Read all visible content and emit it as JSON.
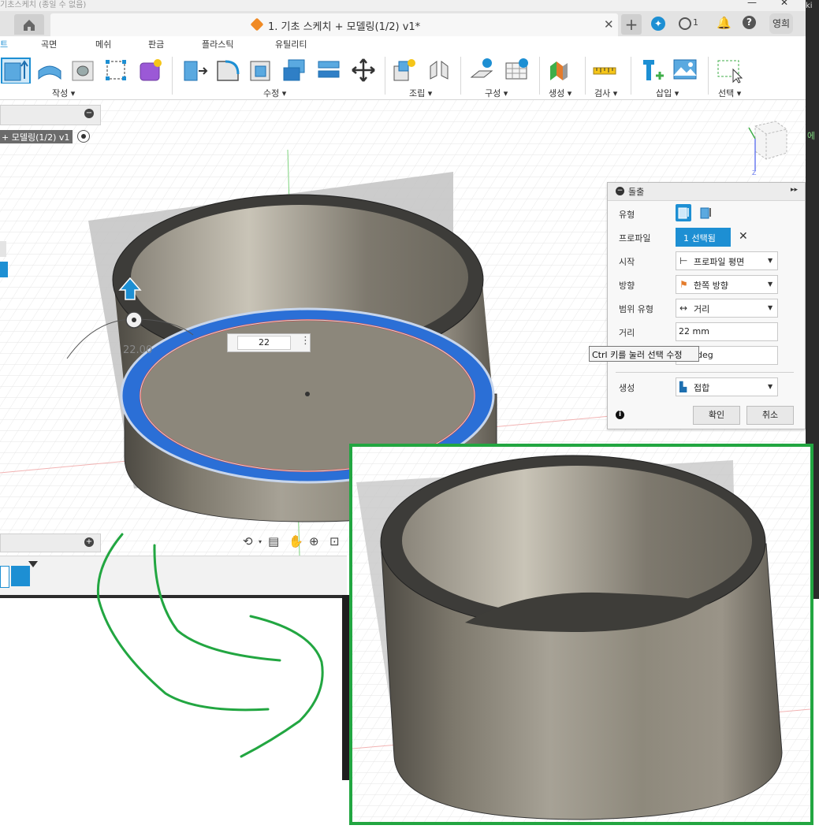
{
  "window": {
    "title_fragment": "기초스케치 (종일 수 없음)",
    "right_edge_text": "ki",
    "right_edge_text2": "에"
  },
  "tabbar": {
    "doc_title": "1. 기초 스케치 + 모델링(1/2) v1*",
    "close_glyph": "✕",
    "plus_glyph": "+",
    "job_count": "1",
    "user_initials": "영희"
  },
  "menu": [
    "트",
    "곡면",
    "메쉬",
    "판금",
    "플라스틱",
    "유틸리티"
  ],
  "toolbar": {
    "groups": [
      "작성 ▾",
      "수정 ▾",
      "조립 ▾",
      "구성 ▾",
      "생성 ▾",
      "검사 ▾",
      "삽입 ▾",
      "선택 ▾"
    ]
  },
  "browser": {
    "item": "+ 모델링(1/2) v1",
    "collapse": "−",
    "expand": "+"
  },
  "viewport": {
    "dimension_value": "22",
    "dimension_label": "22.00"
  },
  "dialog": {
    "title": "돌출",
    "expand_glyph": "▸▸",
    "rows": {
      "type": "유형",
      "profile": "프로파일",
      "start": "시작",
      "direction": "방향",
      "extent": "범위 유형",
      "distance": "거리",
      "operation": "생성"
    },
    "profile_selected": "1 선택됨",
    "start_value": "프로파일 평면",
    "direction_value": "한쪽 방향",
    "extent_value": "거리",
    "distance_value": "22 mm",
    "angle_value": "deg",
    "operation_value": "접합",
    "ok": "확인",
    "cancel": "취소"
  },
  "tooltip": "Ctrl 키를 눌러 선택 수정",
  "colors": {
    "accent": "#1d8fd3",
    "annotation": "#22a641",
    "selection": "#2b6fd6"
  }
}
